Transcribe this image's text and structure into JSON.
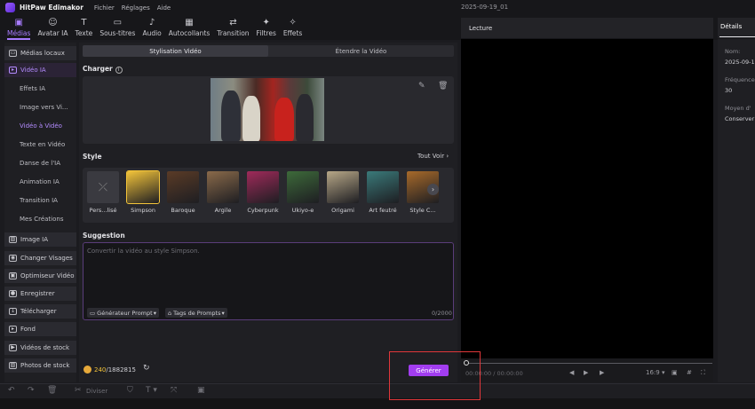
{
  "app": {
    "name": "HitPaw Edimakor",
    "menu": [
      "Fichier",
      "Réglages",
      "Aide"
    ],
    "project": "2025-09-19_01"
  },
  "toolbar": [
    {
      "icon": "media-icon",
      "glyph": "▣",
      "label": "Médias",
      "active": true
    },
    {
      "icon": "ai-avatar-icon",
      "glyph": "☺",
      "label": "Avatar IA"
    },
    {
      "icon": "text-icon",
      "glyph": "T",
      "label": "Texte"
    },
    {
      "icon": "subtitles-icon",
      "glyph": "▭",
      "label": "Sous-titres"
    },
    {
      "icon": "audio-icon",
      "glyph": "♪",
      "label": "Audio"
    },
    {
      "icon": "sticker-icon",
      "glyph": "▦",
      "label": "Autocollants"
    },
    {
      "icon": "transition-icon",
      "glyph": "⇄",
      "label": "Transition"
    },
    {
      "icon": "filter-icon",
      "glyph": "✦",
      "label": "Filtres"
    },
    {
      "icon": "effects-icon",
      "glyph": "✧",
      "label": "Effets"
    }
  ],
  "sidebar": [
    {
      "label": "Médias locaux",
      "type": "head",
      "glyph": "▭"
    },
    {
      "label": "Vidéo IA",
      "type": "active",
      "glyph": "▸"
    },
    {
      "label": "Effets IA",
      "type": "sub"
    },
    {
      "label": "Image vers Vi...",
      "type": "sub"
    },
    {
      "label": "Vidéo à Vidéo",
      "type": "sub-active"
    },
    {
      "label": "Texte en Vidéo",
      "type": "sub"
    },
    {
      "label": "Danse de l'IA",
      "type": "sub"
    },
    {
      "label": "Animation IA",
      "type": "sub"
    },
    {
      "label": "Transition IA",
      "type": "sub"
    },
    {
      "label": "Mes Créations",
      "type": "sub"
    },
    {
      "label": "Image IA",
      "type": "head",
      "glyph": "▨"
    },
    {
      "label": "Changer Visages",
      "type": "head",
      "glyph": "◉"
    },
    {
      "label": "Optimiseur Vidéo",
      "type": "head",
      "glyph": "▣"
    },
    {
      "label": "Enregistrer",
      "type": "head",
      "glyph": "●"
    },
    {
      "label": "Télécharger",
      "type": "head",
      "glyph": "↓"
    },
    {
      "label": "Fond",
      "type": "head",
      "glyph": "▸"
    },
    {
      "label": "Vidéos de stock",
      "type": "head",
      "glyph": "▶"
    },
    {
      "label": "Photos de stock",
      "type": "head",
      "glyph": "▨"
    }
  ],
  "panel": {
    "tabs": [
      {
        "label": "Stylisation Vidéo",
        "active": true
      },
      {
        "label": "Étendre la Vidéo"
      }
    ],
    "upload_label": "Charger",
    "style_label": "Style",
    "see_all": "Tout Voir",
    "styles": [
      {
        "name": "Pers...lisé",
        "color": "#3a3a40"
      },
      {
        "name": "Simpson",
        "color": "#f3c43a",
        "selected": true
      },
      {
        "name": "Baroque",
        "color": "#5a3b26"
      },
      {
        "name": "Argile",
        "color": "#8a6a4a"
      },
      {
        "name": "Cyberpunk",
        "color": "#a02a5a"
      },
      {
        "name": "Ukiyo-e",
        "color": "#3d6a3a"
      },
      {
        "name": "Origami",
        "color": "#b8a888"
      },
      {
        "name": "Art feutré",
        "color": "#3a7a7a"
      },
      {
        "name": "Style C...",
        "color": "#a86a2a"
      }
    ],
    "suggestion_label": "Suggestion",
    "prompt_placeholder": "Convertir la vidéo au style Simpson.",
    "prompt_generator": "Générateur Prompt",
    "prompt_tags": "Tags de Prompts",
    "counter": "0/2000",
    "credits_used": "240",
    "credits_total": "/1882815",
    "generate": "Générer"
  },
  "player": {
    "title": "Lecture",
    "timecode": "00:00:00 / 00:00:00",
    "ratio": "16:9"
  },
  "details": {
    "tab": "Détails",
    "name_label": "Nom:",
    "name_value": "2025-09-1",
    "freq_label": "Fréquence",
    "freq_value": "30",
    "mode_label": "Moyen d'",
    "mode_value": "Conserver"
  },
  "timeline": {
    "split": "Diviser"
  },
  "colors": {
    "accent": "#a87cff",
    "generate": "#a23df0",
    "highlight": "#e0373a"
  }
}
